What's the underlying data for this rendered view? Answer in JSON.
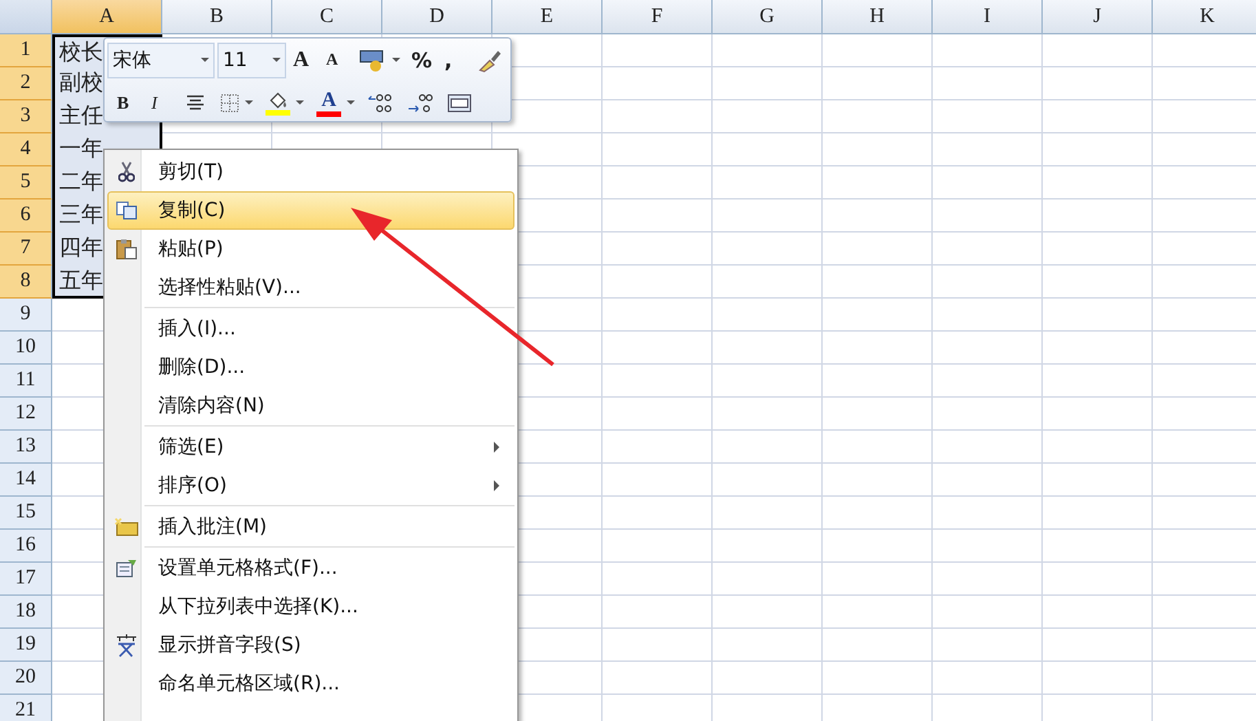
{
  "sheet": {
    "columns": [
      {
        "label": "A",
        "selected": true
      },
      {
        "label": "B",
        "selected": false
      },
      {
        "label": "C",
        "selected": false
      },
      {
        "label": "D",
        "selected": false
      },
      {
        "label": "E",
        "selected": false
      },
      {
        "label": "F",
        "selected": false
      },
      {
        "label": "G",
        "selected": false
      },
      {
        "label": "H",
        "selected": false
      },
      {
        "label": "I",
        "selected": false
      },
      {
        "label": "J",
        "selected": false
      },
      {
        "label": "K",
        "selected": false
      }
    ],
    "rows": [
      {
        "label": "1",
        "selected": true,
        "cell_a": "校长"
      },
      {
        "label": "2",
        "selected": true,
        "cell_a": "副校"
      },
      {
        "label": "3",
        "selected": true,
        "cell_a": "主任"
      },
      {
        "label": "4",
        "selected": true,
        "cell_a": "一年"
      },
      {
        "label": "5",
        "selected": true,
        "cell_a": "二年"
      },
      {
        "label": "6",
        "selected": true,
        "cell_a": "三年"
      },
      {
        "label": "7",
        "selected": true,
        "cell_a": "四年"
      },
      {
        "label": "8",
        "selected": true,
        "cell_a": "五年"
      },
      {
        "label": "9",
        "selected": false
      },
      {
        "label": "10",
        "selected": false
      },
      {
        "label": "11",
        "selected": false
      },
      {
        "label": "12",
        "selected": false
      },
      {
        "label": "13",
        "selected": false
      },
      {
        "label": "14",
        "selected": false
      },
      {
        "label": "15",
        "selected": false
      },
      {
        "label": "16",
        "selected": false
      },
      {
        "label": "17",
        "selected": false
      },
      {
        "label": "18",
        "selected": false
      },
      {
        "label": "19",
        "selected": false
      },
      {
        "label": "20",
        "selected": false
      },
      {
        "label": "21",
        "selected": false
      }
    ]
  },
  "mini_toolbar": {
    "font": "宋体",
    "size": "11",
    "row1": [
      {
        "kind": "grow",
        "label": "A"
      },
      {
        "kind": "shrink",
        "label": "A"
      },
      {
        "kind": "currency"
      },
      {
        "kind": "text",
        "label": "%"
      },
      {
        "kind": "text",
        "label": ","
      },
      {
        "kind": "brush"
      }
    ],
    "row2": [
      {
        "kind": "bold",
        "label": "B"
      },
      {
        "kind": "italic",
        "label": "I"
      },
      {
        "kind": "center"
      },
      {
        "kind": "border"
      },
      {
        "kind": "fill"
      },
      {
        "kind": "fontcolor",
        "label": "A"
      },
      {
        "kind": "incdec"
      },
      {
        "kind": "decdec"
      },
      {
        "kind": "merge"
      }
    ]
  },
  "context_menu": [
    {
      "kind": "item",
      "label": "剪切(T)",
      "selected": false
    },
    {
      "kind": "item",
      "label": "复制(C)",
      "selected": true
    },
    {
      "kind": "item",
      "label": "粘贴(P)",
      "selected": false
    },
    {
      "kind": "item",
      "label": "选择性粘贴(V)...",
      "selected": false
    },
    {
      "kind": "separator"
    },
    {
      "kind": "item",
      "label": "插入(I)...",
      "selected": false
    },
    {
      "kind": "item",
      "label": "删除(D)...",
      "selected": false
    },
    {
      "kind": "item",
      "label": "清除内容(N)",
      "selected": false
    },
    {
      "kind": "separator"
    },
    {
      "kind": "submenu",
      "label": "筛选(E)",
      "selected": false
    },
    {
      "kind": "submenu",
      "label": "排序(O)",
      "selected": false
    },
    {
      "kind": "separator"
    },
    {
      "kind": "item",
      "label": "插入批注(M)",
      "selected": false
    },
    {
      "kind": "separator"
    },
    {
      "kind": "item",
      "label": "设置单元格格式(F)...",
      "selected": false
    },
    {
      "kind": "item",
      "label": "从下拉列表中选择(K)...",
      "selected": false
    },
    {
      "kind": "item",
      "label": "显示拼音字段(S)",
      "selected": false
    },
    {
      "kind": "item",
      "label": "命名单元格区域(R)...",
      "selected": false
    }
  ]
}
